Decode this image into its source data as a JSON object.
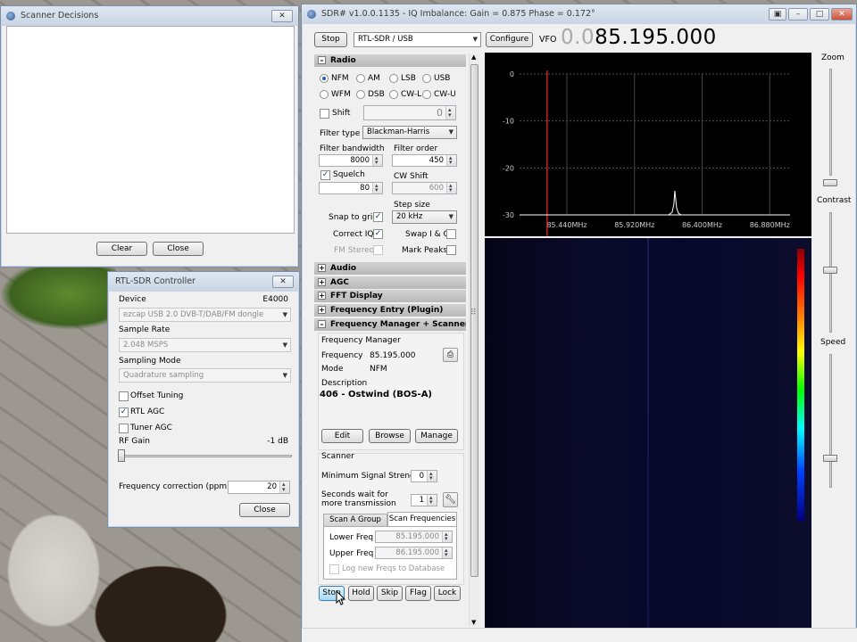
{
  "scanner_window": {
    "title": "Scanner Decisions",
    "clear": "Clear",
    "close": "Close"
  },
  "rtl_window": {
    "title": "RTL-SDR Controller",
    "device_label": "Device",
    "device_value": "E4000",
    "device_combo": "ezcap USB 2.0 DVB-T/DAB/FM dongle",
    "sample_rate_label": "Sample Rate",
    "sample_rate_value": "2.048 MSPS",
    "sampling_mode_label": "Sampling Mode",
    "sampling_mode_value": "Quadrature sampling",
    "offset_tuning": "Offset Tuning",
    "rtl_agc": "RTL AGC",
    "tuner_agc": "Tuner AGC",
    "rf_gain_label": "RF Gain",
    "rf_gain_value": "-1 dB",
    "freq_corr_label": "Frequency correction (ppm)",
    "freq_corr_value": "20",
    "close": "Close"
  },
  "main": {
    "title": "SDR# v1.0.0.1135 - IQ Imbalance: Gain = 0.875 Phase = 0.172°",
    "stop": "Stop",
    "source": "RTL-SDR / USB",
    "configure": "Configure",
    "vfo_label": "VFO",
    "vfo_dim": "0.0",
    "vfo_value": "85.195.000"
  },
  "radio": {
    "header": "Radio",
    "modes": [
      "NFM",
      "AM",
      "LSB",
      "USB",
      "WFM",
      "DSB",
      "CW-L",
      "CW-U"
    ],
    "selected_mode": "NFM",
    "shift": "Shift",
    "shift_value": "0",
    "filter_type_label": "Filter type",
    "filter_type": "Blackman-Harris",
    "filter_bw_label": "Filter bandwidth",
    "filter_bw": "8000",
    "filter_order_label": "Filter order",
    "filter_order": "450",
    "squelch": "Squelch",
    "squelch_value": "80",
    "cw_shift_label": "CW Shift",
    "cw_shift": "600",
    "step_size_label": "Step size",
    "step_size": "20 kHz",
    "snap_to_grid": "Snap to grid",
    "correct_iq": "Correct IQ",
    "swap_iq": "Swap I & Q",
    "fm_stereo": "FM Stereo",
    "mark_peaks": "Mark Peaks"
  },
  "sections": [
    "Audio",
    "AGC",
    "FFT Display",
    "Frequency Entry (Plugin)",
    "Frequency Manager + Scanner (Plug"
  ],
  "freq_manager": {
    "title": "Frequency Manager",
    "frequency_label": "Frequency",
    "frequency": "85.195.000",
    "mode_label": "Mode",
    "mode": "NFM",
    "description_label": "Description",
    "description": "406 - Ostwind (BOS-A)",
    "edit": "Edit",
    "browse": "Browse",
    "manage": "Manage"
  },
  "scanner": {
    "title": "Scanner",
    "min_signal_label": "Minimum Signal Strength",
    "min_signal": "0",
    "seconds_wait_label": "Seconds wait for more transmission",
    "seconds_wait": "1",
    "tab_group": "Scan A Group",
    "tab_freqs": "Scan Frequencies",
    "lower_label": "Lower Freq",
    "lower": "85.195.000",
    "upper_label": "Upper Freq",
    "upper": "86.195.000",
    "log_label": "Log new Freqs to Database",
    "buttons": [
      "Stop",
      "Hold",
      "Skip",
      "Flag",
      "Lock"
    ]
  },
  "right_panel": {
    "zoom": "Zoom",
    "contrast": "Contrast",
    "speed": "Speed"
  },
  "chart_data": {
    "type": "line",
    "title": "",
    "xlabel": "",
    "ylabel": "",
    "x_ticks": [
      "85.440MHz",
      "85.920MHz",
      "86.400MHz",
      "86.880MHz"
    ],
    "y_ticks": [
      "0",
      "-10",
      "-20",
      "-30"
    ],
    "ylim": [
      -30,
      0
    ],
    "peak_x_label": "between 85.920MHz and 86.400MHz",
    "colors": {
      "trace": "#ffffff",
      "marker": "#cc2020",
      "background": "#000000"
    }
  }
}
